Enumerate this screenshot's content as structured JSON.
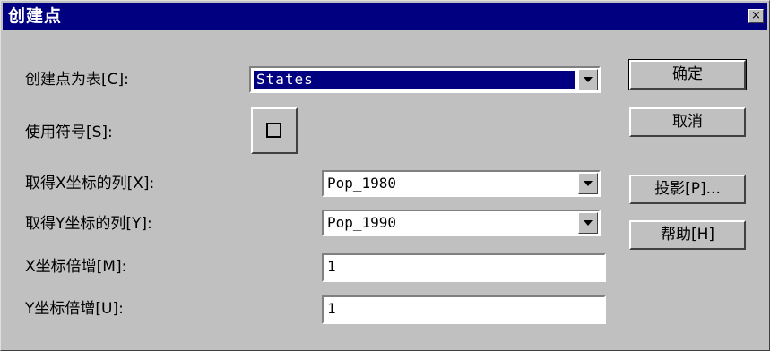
{
  "window": {
    "title": "创建点",
    "close_glyph": "×"
  },
  "labels": {
    "table": "创建点为表[C]:",
    "symbol": "使用符号[S]:",
    "xcol": "取得X坐标的列[X]:",
    "ycol": "取得Y坐标的列[Y]:",
    "xmul": "X坐标倍增[M]:",
    "ymul": "Y坐标倍增[U]:"
  },
  "fields": {
    "table_value": "States",
    "xcol_value": "Pop_1980",
    "ycol_value": "Pop_1990",
    "xmul_value": "1",
    "ymul_value": "1"
  },
  "buttons": {
    "ok": "确定",
    "cancel": "取消",
    "projection": "投影[P]...",
    "help": "帮助[H]"
  },
  "icons": {
    "symbol": "hollow-square-icon",
    "dropdown": "chevron-down-icon"
  }
}
